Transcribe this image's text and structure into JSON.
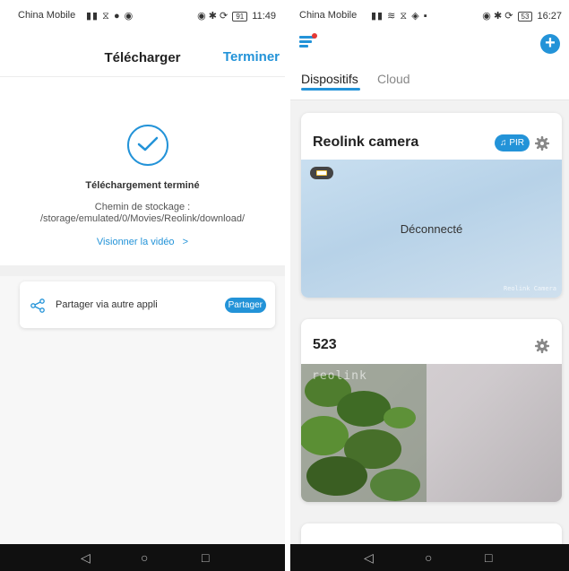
{
  "left": {
    "status": {
      "carrier": "China Mobile",
      "battery": "91",
      "time": "11:49"
    },
    "header": {
      "title": "Télécharger",
      "done_label": "Terminer"
    },
    "result": {
      "title": "Téléchargement terminé",
      "path_label": "Chemin de stockage :",
      "path_value": "/storage/emulated/0/Movies/Reolink/download/",
      "view_link": "Visionner la vidéo",
      "view_chevron": ">"
    },
    "share": {
      "label": "Partager via autre appli",
      "button": "Partager"
    },
    "nav": {
      "back": "◁",
      "home": "○",
      "recent": "□"
    }
  },
  "right": {
    "status": {
      "carrier": "China Mobile",
      "battery": "53",
      "time": "16:27"
    },
    "tabs": [
      {
        "label": "Dispositifs"
      },
      {
        "label": "Cloud"
      }
    ],
    "cameras": [
      {
        "name": "Reolink camera",
        "badge": "PIR",
        "status": "Déconnecté",
        "osd_watermark": "Reolink Camera"
      },
      {
        "name": "523",
        "osd_brand": "reolink"
      }
    ],
    "nav": {
      "back": "◁",
      "home": "○",
      "recent": "□"
    }
  },
  "colors": {
    "accent": "#2393d8",
    "alert_dot": "#e53935"
  }
}
